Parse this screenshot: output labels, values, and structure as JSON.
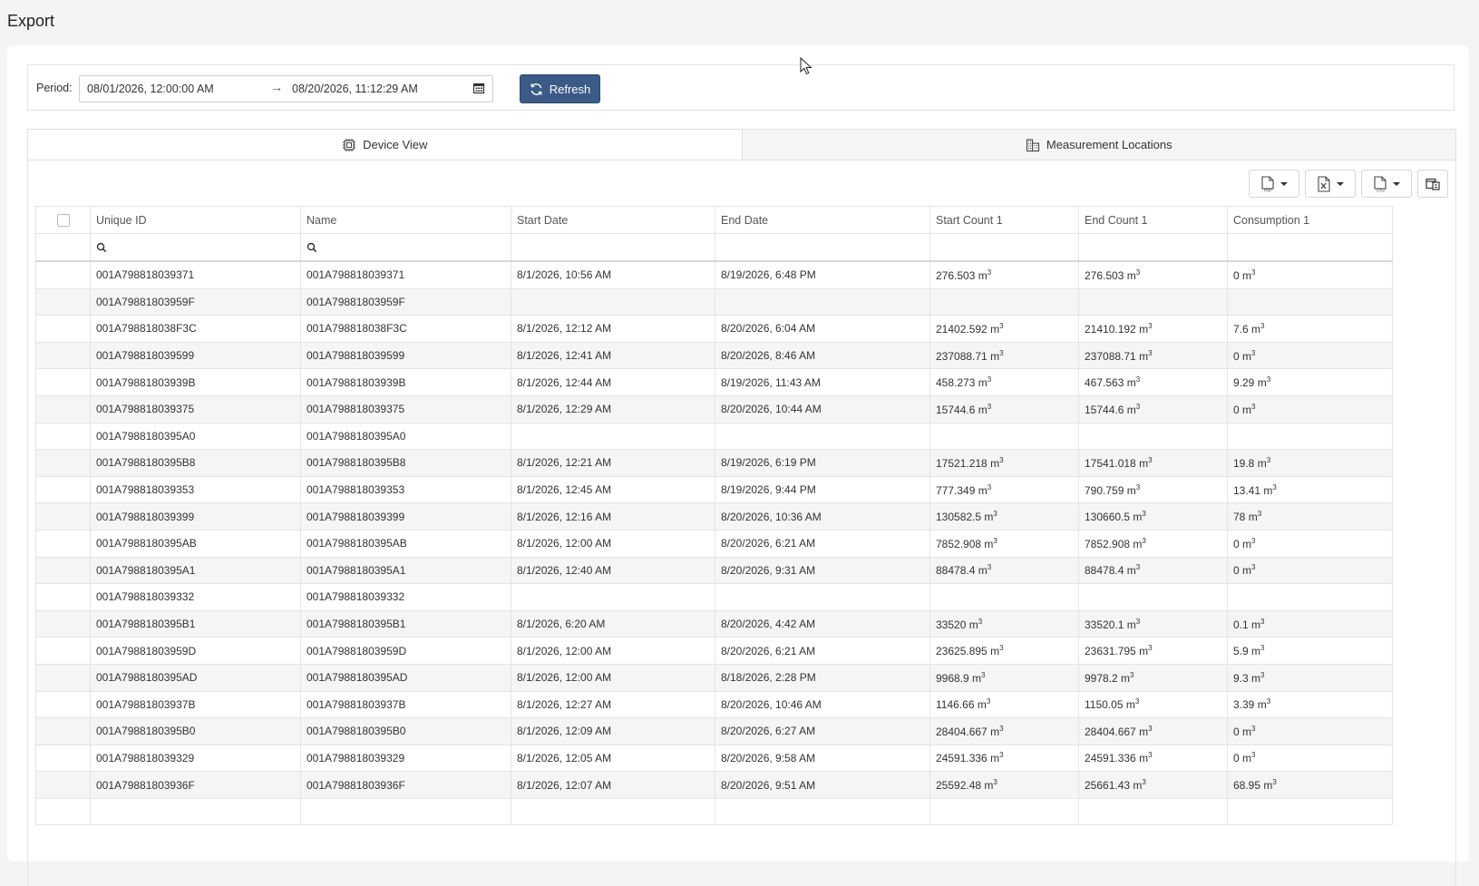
{
  "page": {
    "title": "Export"
  },
  "filter": {
    "period_label": "Period:",
    "from": "08/01/2026, 12:00:00 AM",
    "to": "08/20/2026, 11:12:29 AM",
    "refresh_label": "Refresh"
  },
  "tabs": [
    {
      "label": "Device View",
      "icon": "chip-icon",
      "active": true
    },
    {
      "label": "Measurement Locations",
      "icon": "buildings-icon",
      "active": false
    }
  ],
  "toolbar": [
    "export-pdf",
    "export-excel",
    "export-csv",
    "column-chooser"
  ],
  "columns": [
    "Unique ID",
    "Name",
    "Start Date",
    "End Date",
    "Start Count 1",
    "End Count 1",
    "Consumption 1"
  ],
  "unit": "m",
  "rows": [
    [
      "001A798818039371",
      "001A798818039371",
      "8/1/2026, 10:56 AM",
      "8/19/2026, 6:48 PM",
      "276.503",
      "276.503",
      "0"
    ],
    [
      "001A79881803959F",
      "001A79881803959F",
      "",
      "",
      "",
      "",
      ""
    ],
    [
      "001A798818038F3C",
      "001A798818038F3C",
      "8/1/2026, 12:12 AM",
      "8/20/2026, 6:04 AM",
      "21402.592",
      "21410.192",
      "7.6"
    ],
    [
      "001A798818039599",
      "001A798818039599",
      "8/1/2026, 12:41 AM",
      "8/20/2026, 8:46 AM",
      "237088.71",
      "237088.71",
      "0"
    ],
    [
      "001A79881803939B",
      "001A79881803939B",
      "8/1/2026, 12:44 AM",
      "8/19/2026, 11:43 AM",
      "458.273",
      "467.563",
      "9.29"
    ],
    [
      "001A798818039375",
      "001A798818039375",
      "8/1/2026, 12:29 AM",
      "8/20/2026, 10:44 AM",
      "15744.6",
      "15744.6",
      "0"
    ],
    [
      "001A7988180395A0",
      "001A7988180395A0",
      "",
      "",
      "",
      "",
      ""
    ],
    [
      "001A7988180395B8",
      "001A7988180395B8",
      "8/1/2026, 12:21 AM",
      "8/19/2026, 6:19 PM",
      "17521.218",
      "17541.018",
      "19.8"
    ],
    [
      "001A798818039353",
      "001A798818039353",
      "8/1/2026, 12:45 AM",
      "8/19/2026, 9:44 PM",
      "777.349",
      "790.759",
      "13.41"
    ],
    [
      "001A798818039399",
      "001A798818039399",
      "8/1/2026, 12:16 AM",
      "8/20/2026, 10:36 AM",
      "130582.5",
      "130660.5",
      "78"
    ],
    [
      "001A7988180395AB",
      "001A7988180395AB",
      "8/1/2026, 12:00 AM",
      "8/20/2026, 6:21 AM",
      "7852.908",
      "7852.908",
      "0"
    ],
    [
      "001A7988180395A1",
      "001A7988180395A1",
      "8/1/2026, 12:40 AM",
      "8/20/2026, 9:31 AM",
      "88478.4",
      "88478.4",
      "0"
    ],
    [
      "001A798818039332",
      "001A798818039332",
      "",
      "",
      "",
      "",
      ""
    ],
    [
      "001A7988180395B1",
      "001A7988180395B1",
      "8/1/2026, 6:20 AM",
      "8/20/2026, 4:42 AM",
      "33520",
      "33520.1",
      "0.1"
    ],
    [
      "001A79881803959D",
      "001A79881803959D",
      "8/1/2026, 12:00 AM",
      "8/20/2026, 6:21 AM",
      "23625.895",
      "23631.795",
      "5.9"
    ],
    [
      "001A7988180395AD",
      "001A7988180395AD",
      "8/1/2026, 12:00 AM",
      "8/18/2026, 2:28 PM",
      "9968.9",
      "9978.2",
      "9.3"
    ],
    [
      "001A79881803937B",
      "001A79881803937B",
      "8/1/2026, 12:27 AM",
      "8/20/2026, 10:46 AM",
      "1146.66",
      "1150.05",
      "3.39"
    ],
    [
      "001A7988180395B0",
      "001A7988180395B0",
      "8/1/2026, 12:09 AM",
      "8/20/2026, 6:27 AM",
      "28404.667",
      "28404.667",
      "0"
    ],
    [
      "001A798818039329",
      "001A798818039329",
      "8/1/2026, 12:05 AM",
      "8/20/2026, 9:58 AM",
      "24591.336",
      "24591.336",
      "0"
    ],
    [
      "001A79881803936F",
      "001A79881803936F",
      "8/1/2026, 12:07 AM",
      "8/20/2026, 9:51 AM",
      "25592.48",
      "25661.43",
      "68.95"
    ],
    [
      "",
      "",
      "",
      "",
      "",
      "",
      ""
    ]
  ]
}
